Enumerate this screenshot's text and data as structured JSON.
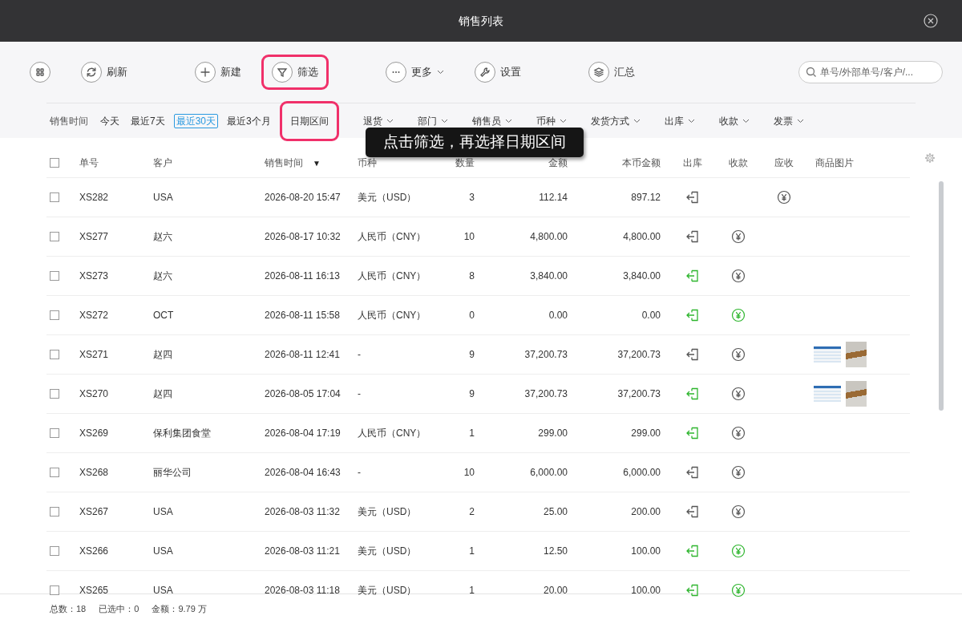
{
  "window": {
    "title": "销售列表"
  },
  "toolbar": {
    "groups": [
      [
        {
          "highlighted": false,
          "dropdown": false
        },
        {
          "label": "刷新",
          "highlighted": false,
          "dropdown": false
        }
      ],
      [
        {
          "label": "新建",
          "highlighted": false,
          "dropdown": false
        },
        {
          "label": "筛选",
          "highlighted": true,
          "dropdown": false
        }
      ],
      [
        {
          "label": "更多",
          "highlighted": false,
          "dropdown": true
        },
        {
          "label": "设置",
          "highlighted": false,
          "dropdown": false
        }
      ],
      [
        {
          "label": "汇总",
          "highlighted": false,
          "dropdown": false
        }
      ]
    ],
    "search": {
      "placeholder": "单号/外部单号/客户/..."
    }
  },
  "filters": {
    "date_label": "销售时间",
    "date_options": [
      {
        "label": "今天",
        "selected": false,
        "highlighted": false
      },
      {
        "label": "最近7天",
        "selected": false,
        "highlighted": false
      },
      {
        "label": "最近30天",
        "selected": true,
        "highlighted": false
      },
      {
        "label": "最近3个月",
        "selected": false,
        "highlighted": false
      },
      {
        "label": "日期区间",
        "selected": false,
        "highlighted": true
      }
    ],
    "dropdowns": [
      "退货",
      "部门",
      "销售员",
      "币种",
      "发货方式",
      "出库",
      "收款",
      "发票"
    ]
  },
  "callout": "点击筛选，再选择日期区间",
  "table": {
    "select_all": {
      "checked": false
    },
    "columns": [
      {
        "label": "单号"
      },
      {
        "label": "客户"
      },
      {
        "label": "销售时间",
        "sort_indicator": "▼"
      },
      {
        "label": "币种"
      },
      {
        "label": "数量"
      },
      {
        "label": "金额"
      },
      {
        "label": "本币金额"
      },
      {
        "label": "出库"
      },
      {
        "label": "收款"
      },
      {
        "label": "应收"
      },
      {
        "label": "商品图片"
      }
    ],
    "rows": [
      {
        "checked": false,
        "number": "XS282",
        "customer": "USA",
        "time": "2026-08-20 15:47",
        "currency": "美元（USD）",
        "quantity": "3",
        "amount": "112.14",
        "base_amount": "897.12",
        "outbound_done": false,
        "payment_shown": false,
        "receivable": true,
        "has_images": false
      },
      {
        "checked": false,
        "number": "XS277",
        "customer": "赵六",
        "time": "2026-08-17 10:32",
        "currency": "人民币（CNY）",
        "quantity": "10",
        "amount": "4,800.00",
        "base_amount": "4,800.00",
        "outbound_done": false,
        "payment_shown": true,
        "payment_done": false,
        "receivable": false,
        "has_images": false
      },
      {
        "checked": false,
        "number": "XS273",
        "customer": "赵六",
        "time": "2026-08-11 16:13",
        "currency": "人民币（CNY）",
        "quantity": "8",
        "amount": "3,840.00",
        "base_amount": "3,840.00",
        "outbound_done": true,
        "payment_shown": true,
        "payment_done": false,
        "receivable": false,
        "has_images": false
      },
      {
        "checked": false,
        "number": "XS272",
        "customer": "OCT",
        "time": "2026-08-11 15:58",
        "currency": "人民币（CNY）",
        "quantity": "0",
        "amount": "0.00",
        "base_amount": "0.00",
        "outbound_done": true,
        "payment_shown": true,
        "payment_done": true,
        "receivable": false,
        "has_images": false
      },
      {
        "checked": false,
        "number": "XS271",
        "customer": "赵四",
        "time": "2026-08-11 12:41",
        "currency": "-",
        "quantity": "9",
        "amount": "37,200.73",
        "base_amount": "37,200.73",
        "outbound_done": false,
        "payment_shown": true,
        "payment_done": false,
        "receivable": false,
        "has_images": true
      },
      {
        "checked": false,
        "number": "XS270",
        "customer": "赵四",
        "time": "2026-08-05 17:04",
        "currency": "-",
        "quantity": "9",
        "amount": "37,200.73",
        "base_amount": "37,200.73",
        "outbound_done": true,
        "payment_shown": true,
        "payment_done": false,
        "receivable": false,
        "has_images": true
      },
      {
        "checked": false,
        "number": "XS269",
        "customer": "保利集团食堂",
        "time": "2026-08-04 17:19",
        "currency": "人民币（CNY）",
        "quantity": "1",
        "amount": "299.00",
        "base_amount": "299.00",
        "outbound_done": true,
        "payment_shown": true,
        "payment_done": false,
        "receivable": false,
        "has_images": false
      },
      {
        "checked": false,
        "number": "XS268",
        "customer": "丽华公司",
        "time": "2026-08-04 16:43",
        "currency": "-",
        "quantity": "10",
        "amount": "6,000.00",
        "base_amount": "6,000.00",
        "outbound_done": false,
        "payment_shown": true,
        "payment_done": false,
        "receivable": false,
        "has_images": false
      },
      {
        "checked": false,
        "number": "XS267",
        "customer": "USA",
        "time": "2026-08-03 11:32",
        "currency": "美元（USD）",
        "quantity": "2",
        "amount": "25.00",
        "base_amount": "200.00",
        "outbound_done": false,
        "payment_shown": true,
        "payment_done": false,
        "receivable": false,
        "has_images": false
      },
      {
        "checked": false,
        "number": "XS266",
        "customer": "USA",
        "time": "2026-08-03 11:21",
        "currency": "美元（USD）",
        "quantity": "1",
        "amount": "12.50",
        "base_amount": "100.00",
        "outbound_done": true,
        "payment_shown": true,
        "payment_done": true,
        "receivable": false,
        "has_images": false
      },
      {
        "checked": false,
        "number": "XS265",
        "customer": "USA",
        "time": "2026-08-03 11:18",
        "currency": "美元（USD）",
        "quantity": "1",
        "amount": "20.00",
        "base_amount": "100.00",
        "outbound_done": true,
        "payment_shown": true,
        "payment_done": true,
        "receivable": false,
        "has_images": false
      }
    ]
  },
  "status_bar": [
    {
      "label": "总数：",
      "value": "18"
    },
    {
      "label": "已选中：",
      "value": "0"
    },
    {
      "label": "金额：",
      "value": "9.79 万"
    }
  ]
}
